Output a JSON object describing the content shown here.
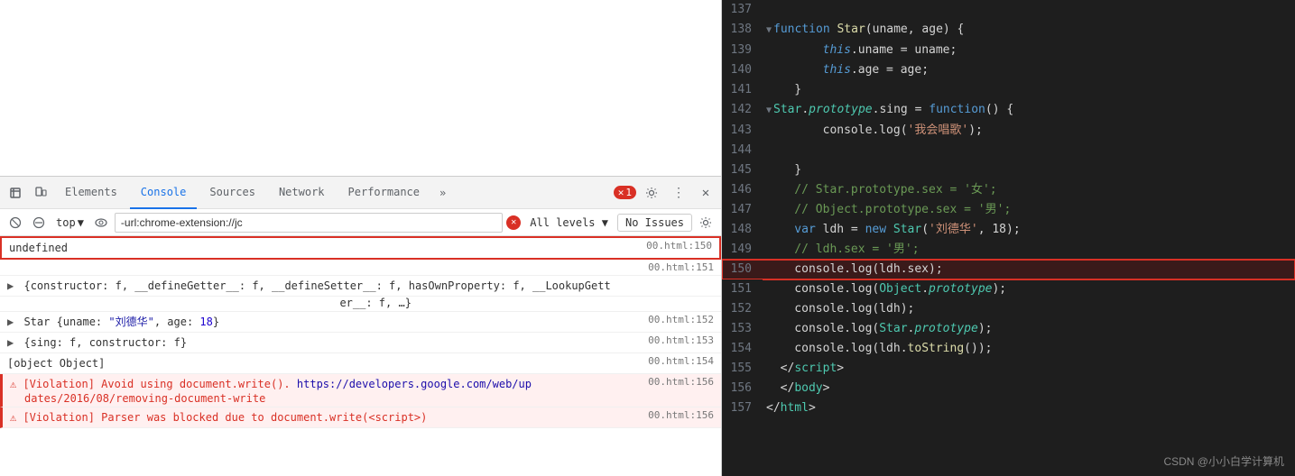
{
  "left": {
    "devtools_tabs": [
      "Elements",
      "Console",
      "Sources",
      "Network",
      "Performance"
    ],
    "active_tab": "Console",
    "more_label": "»",
    "error_count": "1",
    "toolbar": {
      "context": "top",
      "filter_placeholder": "-url:chrome-extension://jc",
      "levels_label": "All levels ▼",
      "no_issues_label": "No Issues"
    },
    "console_entries": [
      {
        "id": "e1",
        "text": "undefined",
        "location": "00.html:150",
        "type": "undefined"
      },
      {
        "id": "e2",
        "text": "",
        "location": "00.html:151",
        "type": "spacer"
      },
      {
        "id": "e3",
        "text": "{constructor: f, __defineGetter__: f, __defineSetter__: f, hasOwnProperty: f, __LookupGetter__: f, …}",
        "location": "",
        "type": "object",
        "expandable": true
      },
      {
        "id": "e4",
        "text": "Star {uname: \"刘德华\", age: 18}",
        "location": "00.html:152",
        "type": "object",
        "expandable": true
      },
      {
        "id": "e5",
        "text": "{sing: f, constructor: f}",
        "location": "00.html:153",
        "type": "object",
        "expandable": true
      },
      {
        "id": "e6",
        "text": "[object Object]",
        "location": "00.html:154",
        "type": "plain"
      },
      {
        "id": "e7",
        "text": "⚠ [Violation] Avoid using document.write().",
        "link_text": "https://developers.google.com/web/up",
        "link_after": "",
        "location": "00.html:156",
        "type": "violation",
        "extra": "dates/2016/08/removing-document-write"
      },
      {
        "id": "e8",
        "text": "⚠ [Violation] Parser was blocked due to document.write(<script>)",
        "location": "00.html:156",
        "type": "violation"
      }
    ]
  },
  "right": {
    "lines": [
      {
        "num": "137",
        "tokens": []
      },
      {
        "num": "138",
        "tokens": [
          {
            "t": "kw-blue",
            "v": "function "
          },
          {
            "t": "kw-yellow",
            "v": "Star"
          },
          {
            "t": "plain",
            "v": "(uname, age) {"
          }
        ],
        "collapse": true
      },
      {
        "num": "139",
        "tokens": [
          {
            "t": "kw-this",
            "v": "        this"
          },
          {
            "t": "plain",
            "v": ".uname = uname;"
          }
        ]
      },
      {
        "num": "140",
        "tokens": [
          {
            "t": "kw-this",
            "v": "        this"
          },
          {
            "t": "plain",
            "v": ".age = age;"
          }
        ]
      },
      {
        "num": "141",
        "tokens": [
          {
            "t": "plain",
            "v": "    }"
          }
        ]
      },
      {
        "num": "142",
        "tokens": [
          {
            "t": "kw-object",
            "v": "    Star"
          },
          {
            "t": "plain",
            "v": "."
          },
          {
            "t": "kw-prototype",
            "v": "prototype"
          },
          {
            "t": "plain",
            "v": ".sing = "
          },
          {
            "t": "kw-blue",
            "v": "function"
          },
          {
            "t": "plain",
            "v": "() {"
          }
        ],
        "collapse": true
      },
      {
        "num": "143",
        "tokens": [
          {
            "t": "plain",
            "v": "        console.log("
          },
          {
            "t": "kw-string",
            "v": "'我会唱歌'"
          },
          {
            "t": "plain",
            "v": ");"
          }
        ]
      },
      {
        "num": "144",
        "tokens": []
      },
      {
        "num": "145",
        "tokens": [
          {
            "t": "plain",
            "v": "    }"
          }
        ]
      },
      {
        "num": "146",
        "tokens": [
          {
            "t": "comment",
            "v": "    // Star.prototype.sex = '女';"
          }
        ]
      },
      {
        "num": "147",
        "tokens": [
          {
            "t": "comment",
            "v": "    // Object.prototype.sex = '男';"
          }
        ]
      },
      {
        "num": "148",
        "tokens": [
          {
            "t": "kw-var",
            "v": "    var "
          },
          {
            "t": "plain",
            "v": "ldh = "
          },
          {
            "t": "kw-new",
            "v": "new "
          },
          {
            "t": "kw-object",
            "v": "Star"
          },
          {
            "t": "plain",
            "v": "("
          },
          {
            "t": "kw-string",
            "v": "'刘德华'"
          },
          {
            "t": "plain",
            "v": ", 18);"
          }
        ]
      },
      {
        "num": "149",
        "tokens": [
          {
            "t": "comment",
            "v": "    // ldh.sex = '男';"
          }
        ]
      },
      {
        "num": "150",
        "tokens": [
          {
            "t": "plain",
            "v": "    console.log(ldh.sex);"
          }
        ],
        "highlight": true,
        "redbox": true
      },
      {
        "num": "151",
        "tokens": [
          {
            "t": "plain",
            "v": "    console.log("
          },
          {
            "t": "kw-object",
            "v": "Object"
          },
          {
            "t": "plain",
            "v": "."
          },
          {
            "t": "kw-prototype",
            "v": "prototype"
          },
          {
            "t": "plain",
            "v": ");"
          }
        ]
      },
      {
        "num": "152",
        "tokens": [
          {
            "t": "plain",
            "v": "    console.log(ldh);"
          }
        ]
      },
      {
        "num": "153",
        "tokens": [
          {
            "t": "plain",
            "v": "    console.log("
          },
          {
            "t": "kw-object",
            "v": "Star"
          },
          {
            "t": "plain",
            "v": "."
          },
          {
            "t": "kw-prototype",
            "v": "prototype"
          },
          {
            "t": "plain",
            "v": ");"
          }
        ]
      },
      {
        "num": "154",
        "tokens": [
          {
            "t": "plain",
            "v": "    console.log(ldh."
          },
          {
            "t": "kw-yellow",
            "v": "toString"
          },
          {
            "t": "plain",
            "v": "());"
          }
        ]
      },
      {
        "num": "155",
        "tokens": [
          {
            "t": "plain",
            "v": "  </"
          },
          {
            "t": "tag-script",
            "v": "script"
          },
          {
            "t": "plain",
            "v": ">"
          }
        ]
      },
      {
        "num": "156",
        "tokens": [
          {
            "t": "plain",
            "v": "  </"
          },
          {
            "t": "tag-body",
            "v": "body"
          },
          {
            "t": "plain",
            "v": ">"
          }
        ]
      },
      {
        "num": "157",
        "tokens": [
          {
            "t": "plain",
            "v": "</"
          },
          {
            "t": "tag-html",
            "v": "html"
          },
          {
            "t": "plain",
            "v": ">"
          }
        ]
      }
    ],
    "watermark": "CSDN @小小白学计算机"
  }
}
